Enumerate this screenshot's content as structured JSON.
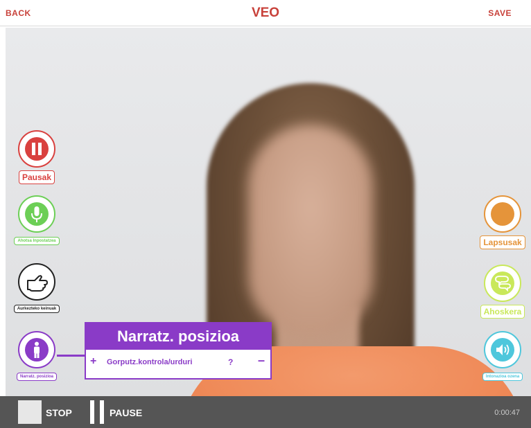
{
  "header": {
    "back_label": "BACK",
    "title": "VEO",
    "save_label": "SAVE"
  },
  "left_tools": [
    {
      "label": "Pausak",
      "icon": "pause-icon",
      "color": "#d9413f"
    },
    {
      "label": "Ahotsa Inpostatzea",
      "icon": "microphone-icon",
      "color": "#6ccf56"
    },
    {
      "label": "Aurkezteko keinuak",
      "icon": "hand-pointing-icon",
      "color": "#222222"
    },
    {
      "label": "Narratz. posizioa",
      "icon": "person-icon",
      "color": "#8a3bc7"
    }
  ],
  "right_tools": [
    {
      "label": "Lapsusak",
      "icon": "square-icon",
      "color": "#e5943a"
    },
    {
      "label": "Ahoskera",
      "icon": "speech-bubbles-icon",
      "color": "#c9e85a"
    },
    {
      "label": "Intonazioa ozena",
      "icon": "speaker-icon",
      "color": "#4ec7dc"
    }
  ],
  "popup": {
    "title": "Narratz. posizioa",
    "plus": "+",
    "item": "Gorputz.kontrola/urduri",
    "help": "?",
    "minus": "–"
  },
  "controls": {
    "stop_label": "STOP",
    "pause_label": "PAUSE",
    "time": "0:00:47"
  }
}
